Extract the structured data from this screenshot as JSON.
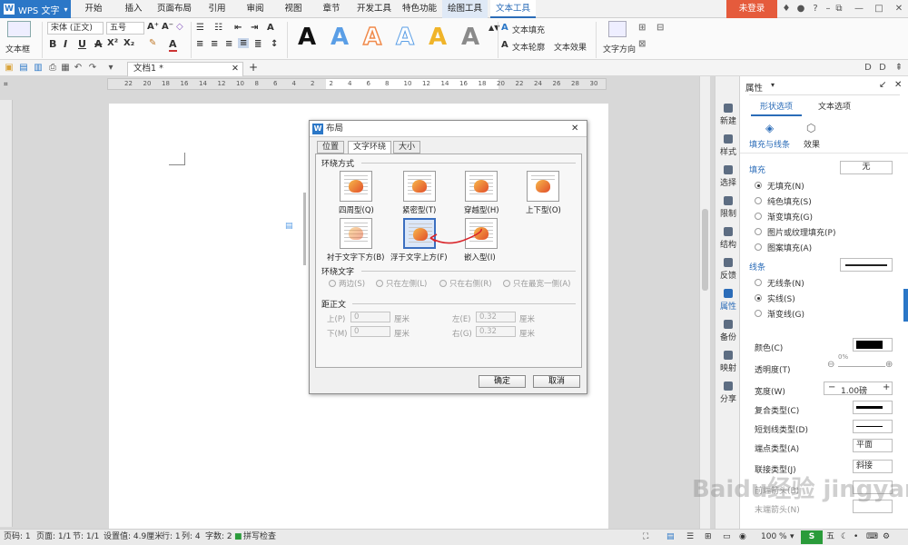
{
  "titlebar": {
    "app_name": "WPS 文字",
    "tabs": [
      "开始",
      "插入",
      "页面布局",
      "引用",
      "审阅",
      "视图",
      "章节",
      "开发工具",
      "特色功能",
      "绘图工具",
      "文本工具"
    ],
    "login": "未登录"
  },
  "ribbon": {
    "textbox_label": "文本框",
    "font_name": "宋体 (正文)",
    "font_size": "五号",
    "text_fill": "文本填充",
    "text_outline": "文本轮廓",
    "text_effect": "文本效果",
    "text_direction": "文字方向",
    "colors": {
      "accent": "#2b77c7",
      "style_blue": "#5a9ee6",
      "style_orange": "#f08a4b",
      "style_yellow": "#f0b429",
      "style_gray": "#8a8a8a"
    }
  },
  "document_tab": "文档1 *",
  "ruler_ticks": [
    "22",
    "20",
    "18",
    "16",
    "14",
    "12",
    "10",
    "8",
    "6",
    "4",
    "2",
    "2",
    "4",
    "6",
    "8",
    "10",
    "12",
    "14",
    "16",
    "18",
    "20",
    "22",
    "24",
    "26",
    "28",
    "30"
  ],
  "dialog": {
    "title": "布局",
    "tabs": [
      "位置",
      "文字环绕",
      "大小"
    ],
    "wrap_section": "环绕方式",
    "wrap_styles": [
      "四周型(Q)",
      "紧密型(T)",
      "穿越型(H)",
      "上下型(O)",
      "衬于文字下方(B)",
      "浮于文字上方(F)",
      "嵌入型(I)"
    ],
    "wrap_text_section": "环绕文字",
    "wrap_text_options": [
      "两边(S)",
      "只在左侧(L)",
      "只在右侧(R)",
      "只在最宽一侧(A)"
    ],
    "distance_section": "距正文",
    "distance": {
      "top_label": "上(P)",
      "top_value": "0",
      "top_unit": "厘米",
      "bottom_label": "下(M)",
      "bottom_value": "0",
      "bottom_unit": "厘米",
      "left_label": "左(E)",
      "left_value": "0.32",
      "left_unit": "厘米",
      "right_label": "右(G)",
      "right_value": "0.32",
      "right_unit": "厘米"
    },
    "ok": "确定",
    "cancel": "取消"
  },
  "side_bar": [
    "新建",
    "样式",
    "选择",
    "限制",
    "结构",
    "反馈",
    "属性",
    "备份",
    "映射",
    "分享"
  ],
  "panel": {
    "title": "属性",
    "tabs": [
      "形状选项",
      "文本选项"
    ],
    "subtabs": [
      "填充与线条",
      "效果"
    ],
    "fill_label": "填充",
    "fill_value": "无",
    "fill_options": [
      "无填充(N)",
      "纯色填充(S)",
      "渐变填充(G)",
      "图片或纹理填充(P)",
      "图案填充(A)"
    ],
    "line_label": "线条",
    "line_options": [
      "无线条(N)",
      "实线(S)",
      "渐变线(G)"
    ],
    "color_label": "颜色(C)",
    "transparency_label": "透明度(T)",
    "transparency_value": "0%",
    "width_label": "宽度(W)",
    "width_value": "1.00磅",
    "compound_label": "复合类型(C)",
    "dash_label": "短划线类型(D)",
    "cap_label": "端点类型(A)",
    "cap_value": "平面",
    "join_label": "联接类型(J)",
    "join_value": "斜接",
    "start_arrow_label": "前端箭头(B)",
    "end_arrow_label": "末端箭头(N)"
  },
  "status": {
    "page_no": "页码: 1",
    "pages": "页面: 1/1",
    "section": "节: 1/1",
    "setting": "设置值: 4.9厘米",
    "row": "行: 1",
    "col": "列: 4",
    "words": "字数: 2",
    "spell": "拼写检查",
    "zoom": "100 %"
  },
  "watermark": "Baidu经验 jingyan.baidu.com"
}
